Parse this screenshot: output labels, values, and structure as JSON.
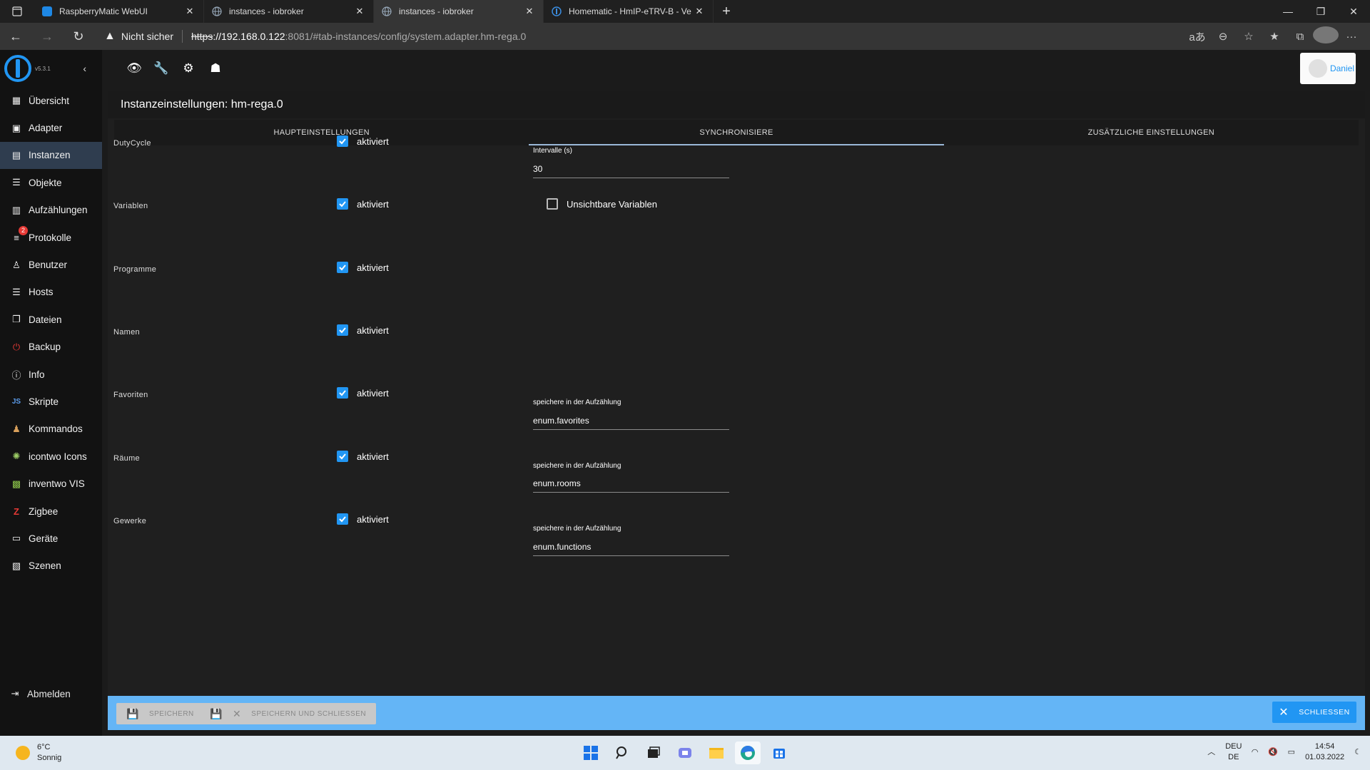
{
  "browser": {
    "tabs": [
      {
        "title": "RaspberryMatic WebUI",
        "active": false
      },
      {
        "title": "instances - iobroker",
        "active": false
      },
      {
        "title": "instances - iobroker",
        "active": true
      },
      {
        "title": "Homematic - HmIP-eTRV-B - Ve",
        "active": false
      }
    ],
    "security_warning": "Nicht sicher",
    "url_scheme": "https",
    "url_host": "://192.168.0.122",
    "url_rest": ":8081/#tab-instances/config/system.adapter.hm-rega.0"
  },
  "sidebar": {
    "version": "v5.3.1",
    "items": [
      {
        "label": "Übersicht",
        "icon": "grid-icon"
      },
      {
        "label": "Adapter",
        "icon": "store-icon"
      },
      {
        "label": "Instanzen",
        "icon": "instances-icon",
        "active": true
      },
      {
        "label": "Objekte",
        "icon": "list-icon"
      },
      {
        "label": "Aufzählungen",
        "icon": "enum-icon"
      },
      {
        "label": "Protokolle",
        "icon": "log-icon",
        "badge": "2"
      },
      {
        "label": "Benutzer",
        "icon": "user-icon"
      },
      {
        "label": "Hosts",
        "icon": "hosts-icon"
      },
      {
        "label": "Dateien",
        "icon": "files-icon"
      },
      {
        "label": "Backup",
        "icon": "backup-icon"
      },
      {
        "label": "Info",
        "icon": "info-icon"
      },
      {
        "label": "Skripte",
        "icon": "js-icon"
      },
      {
        "label": "Kommandos",
        "icon": "command-icon"
      },
      {
        "label": "icontwo Icons",
        "icon": "icontwo-icon"
      },
      {
        "label": "inventwo VIS",
        "icon": "inventwo-icon"
      },
      {
        "label": "Zigbee",
        "icon": "zigbee-icon"
      },
      {
        "label": "Geräte",
        "icon": "devices-icon"
      },
      {
        "label": "Szenen",
        "icon": "scenes-icon"
      }
    ],
    "logout": "Abmelden"
  },
  "toolbar": {
    "user": "Daniel"
  },
  "panel": {
    "title": "Instanzeinstellungen: hm-rega.0",
    "tabs": [
      "HAUPTEINSTELLUNGEN",
      "SYNCHRONISIERE",
      "ZUSÄTZLICHE EINSTELLUNGEN"
    ],
    "active_tab": "SYNCHRONISIERE",
    "checkbox_text": "aktiviert",
    "rows": [
      {
        "label": "DutyCycle",
        "checked": true
      },
      {
        "label": "Variablen",
        "checked": true
      },
      {
        "label": "Programme",
        "checked": true
      },
      {
        "label": "Namen",
        "checked": true
      },
      {
        "label": "Favoriten",
        "checked": true
      },
      {
        "label": "Räume",
        "checked": true
      },
      {
        "label": "Gewerke",
        "checked": true
      }
    ],
    "interval_label": "Intervalle (s)",
    "interval_value": "30",
    "invisible_vars_label": "Unsichtbare Variablen",
    "invisible_vars_checked": false,
    "enum_label": "speichere in der Aufzählung",
    "enum_favorites": "enum.favorites",
    "enum_rooms": "enum.rooms",
    "enum_functions": "enum.functions"
  },
  "actions": {
    "save": "SPEICHERN",
    "save_close": "SPEICHERN UND SCHLIESSEN",
    "close": "SCHLIESSEN"
  },
  "taskbar": {
    "temp": "6°C",
    "weather": "Sonnig",
    "lang1": "DEU",
    "lang2": "DE",
    "time": "14:54",
    "date": "01.03.2022"
  },
  "colors": {
    "accent": "#2196f3",
    "action_bar": "#64b5f6",
    "sidebar_active": "#2f3d4f"
  }
}
